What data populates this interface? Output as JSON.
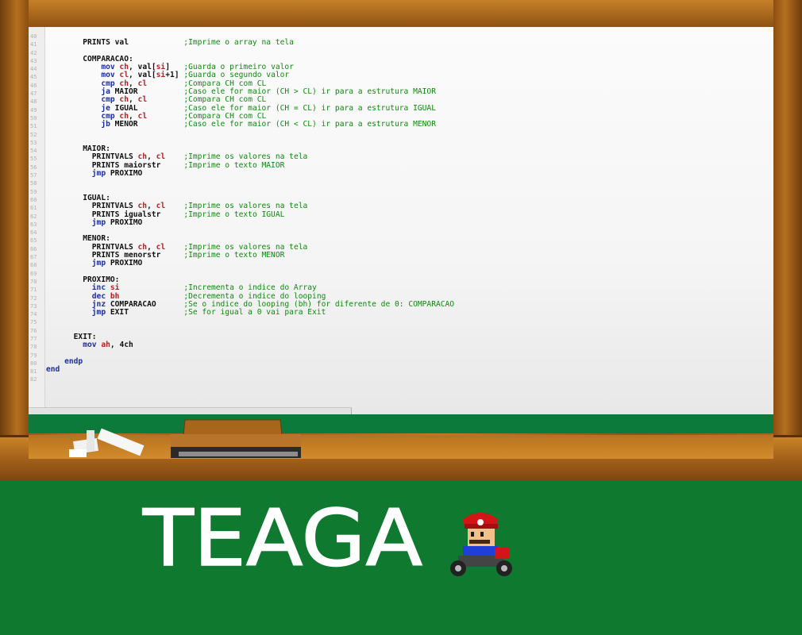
{
  "code_lines": [
    {
      "n": "40",
      "code": "",
      "comment": ""
    },
    {
      "n": "41",
      "code": "        PRINTS val",
      "comment": ";Imprime o array na tela"
    },
    {
      "n": "42",
      "code": "",
      "comment": ""
    },
    {
      "n": "43",
      "code": "        COMPARACAO:",
      "comment": ""
    },
    {
      "n": "44",
      "code": "            mov ch, val[si]",
      "comment": ";Guarda o primeiro valor"
    },
    {
      "n": "45",
      "code": "            mov cl, val[si+1]",
      "comment": ";Guarda o segundo valor"
    },
    {
      "n": "46",
      "code": "            cmp ch, cl",
      "comment": ";Compara CH com CL"
    },
    {
      "n": "47",
      "code": "            ja MAIOR",
      "comment": ";Caso ele for maior (CH > CL) ir para a estrutura MAIOR"
    },
    {
      "n": "48",
      "code": "            cmp ch, cl",
      "comment": ";Compara CH com CL"
    },
    {
      "n": "49",
      "code": "            je IGUAL",
      "comment": ";Caso ele for maior (CH = CL) ir para a estrutura IGUAL"
    },
    {
      "n": "50",
      "code": "            cmp ch, cl",
      "comment": ";Compara CH com CL"
    },
    {
      "n": "51",
      "code": "            jb MENOR",
      "comment": ";Caso ele for maior (CH < CL) ir para a estrutura MENOR"
    },
    {
      "n": "52",
      "code": "",
      "comment": ""
    },
    {
      "n": "53",
      "code": "",
      "comment": ""
    },
    {
      "n": "54",
      "code": "        MAIOR:",
      "comment": ""
    },
    {
      "n": "55",
      "code": "          PRINTVALS ch, cl",
      "comment": ";Imprime os valores na tela"
    },
    {
      "n": "56",
      "code": "          PRINTS maiorstr",
      "comment": ";Imprime o texto MAIOR"
    },
    {
      "n": "57",
      "code": "          jmp PROXIMO",
      "comment": ""
    },
    {
      "n": "58",
      "code": "",
      "comment": ""
    },
    {
      "n": "59",
      "code": "",
      "comment": ""
    },
    {
      "n": "60",
      "code": "        IGUAL:",
      "comment": ""
    },
    {
      "n": "61",
      "code": "          PRINTVALS ch, cl",
      "comment": ";Imprime os valores na tela"
    },
    {
      "n": "62",
      "code": "          PRINTS igualstr",
      "comment": ";Imprime o texto IGUAL"
    },
    {
      "n": "63",
      "code": "          jmp PROXIMO",
      "comment": ""
    },
    {
      "n": "64",
      "code": "",
      "comment": ""
    },
    {
      "n": "65",
      "code": "        MENOR:",
      "comment": ""
    },
    {
      "n": "66",
      "code": "          PRINTVALS ch, cl",
      "comment": ";Imprime os valores na tela"
    },
    {
      "n": "67",
      "code": "          PRINTS menorstr",
      "comment": ";Imprime o texto MENOR"
    },
    {
      "n": "68",
      "code": "          jmp PROXIMO",
      "comment": ""
    },
    {
      "n": "69",
      "code": "",
      "comment": ""
    },
    {
      "n": "70",
      "code": "        PROXIMO:",
      "comment": ""
    },
    {
      "n": "71",
      "code": "          inc si",
      "comment": ";Incrementa o indice do Array"
    },
    {
      "n": "72",
      "code": "          dec bh",
      "comment": ";Decrementa o indice do looping"
    },
    {
      "n": "73",
      "code": "          jnz COMPARACAO",
      "comment": ";Se o indice do looping (bh) for diferente de 0: COMPARACAO"
    },
    {
      "n": "74",
      "code": "          jmp EXIT",
      "comment": ";Se for igual a 0 vai para Exit"
    },
    {
      "n": "75",
      "code": "",
      "comment": ""
    },
    {
      "n": "76",
      "code": "",
      "comment": ""
    },
    {
      "n": "77",
      "code": "      EXIT:",
      "comment": ""
    },
    {
      "n": "78",
      "code": "        mov ah, 4ch",
      "comment": ""
    },
    {
      "n": "79",
      "code": "",
      "comment": ""
    },
    {
      "n": "80",
      "code": "    endp",
      "comment": ""
    },
    {
      "n": "81",
      "code": "end",
      "comment": ""
    },
    {
      "n": "82",
      "code": "",
      "comment": ""
    }
  ],
  "chalk_title": "TEAGA",
  "colors": {
    "keyword": "#1c2e9c",
    "register": "#b22222",
    "comment": "#0d8a0d",
    "board_green": "#0f7a2f",
    "wood": "#b06a1c"
  },
  "icons": {
    "character": "mario-kart-icon",
    "eraser": "eraser-icon",
    "chalk": "chalk-icon"
  }
}
